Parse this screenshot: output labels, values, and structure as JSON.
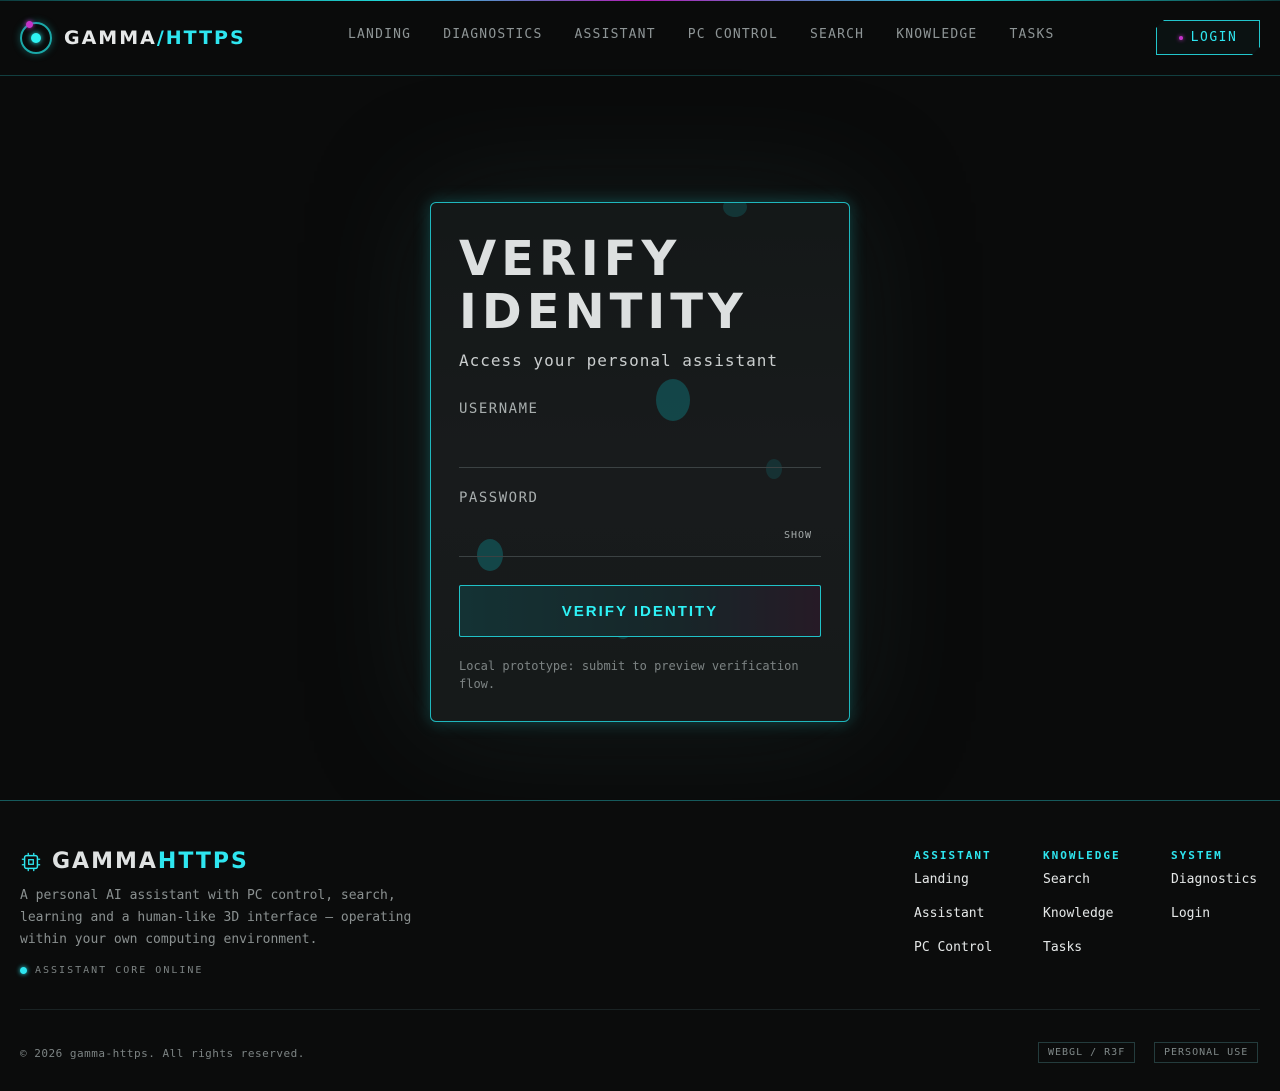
{
  "brand": {
    "name": "GAMMA",
    "suffix": "/HTTPS"
  },
  "nav": {
    "items": [
      "LANDING",
      "DIAGNOSTICS",
      "ASSISTANT",
      "PC CONTROL",
      "SEARCH",
      "KNOWLEDGE",
      "TASKS"
    ],
    "login_label": "LOGIN"
  },
  "card": {
    "title_line1": "VERIFY",
    "title_line2": "IDENTITY",
    "subtitle": "Access your personal assistant",
    "username_label": "USERNAME",
    "username_value": "",
    "password_label": "PASSWORD",
    "password_value": "",
    "show_label": "SHOW",
    "submit_label": "VERIFY IDENTITY",
    "note": "Local prototype: submit to preview verification flow."
  },
  "footer": {
    "brand_name": "GAMMA",
    "brand_accent": "HTTPS",
    "description": "A personal AI assistant with PC control, search, learning and a human-like 3D interface — operating within your own computing environment.",
    "status": "ASSISTANT CORE ONLINE",
    "columns": [
      {
        "heading": "ASSISTANT",
        "links": [
          "Landing",
          "Assistant",
          "PC Control"
        ]
      },
      {
        "heading": "KNOWLEDGE",
        "links": [
          "Search",
          "Knowledge",
          "Tasks"
        ]
      },
      {
        "heading": "SYSTEM",
        "links": [
          "Diagnostics",
          "Login"
        ]
      }
    ],
    "copyright": "© 2026 gamma-https. All rights reserved.",
    "tags": [
      "WEBGL / R3F",
      "PERSONAL USE"
    ]
  },
  "colors": {
    "accent": "#2ee6f0",
    "magenta": "#c532c9",
    "background": "#0a0b0b"
  },
  "icons": [
    "logo-orb-icon",
    "chip-icon",
    "status-dot-icon"
  ]
}
